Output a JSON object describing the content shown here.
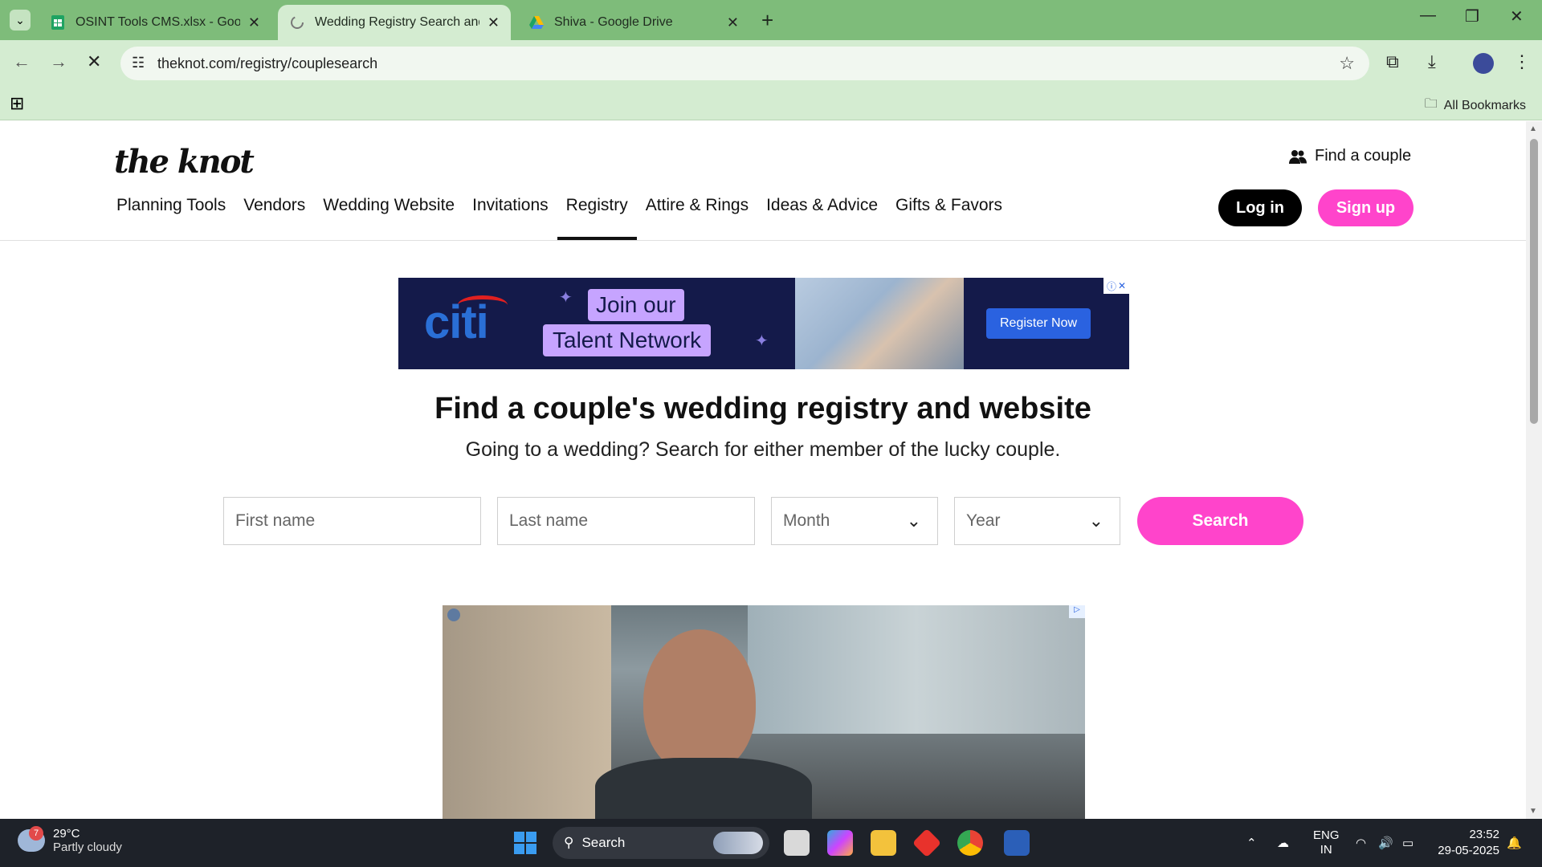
{
  "browser": {
    "tabs": [
      {
        "title": "OSINT Tools CMS.xlsx - Google",
        "icon": "sheets-icon",
        "active": false
      },
      {
        "title": "Wedding Registry Search and W",
        "icon": "loading-icon",
        "active": true
      },
      {
        "title": "Shiva - Google Drive",
        "icon": "drive-icon",
        "active": false
      }
    ],
    "url": "theknot.com/registry/couplesearch",
    "bookmarks_label": "All Bookmarks"
  },
  "site": {
    "logo": "the knot",
    "find_couple": "Find a couple",
    "nav": [
      "Planning Tools",
      "Vendors",
      "Wedding Website",
      "Invitations",
      "Registry",
      "Attire & Rings",
      "Ideas & Advice",
      "Gifts & Favors"
    ],
    "active_nav": "Registry",
    "login": "Log in",
    "signup": "Sign up"
  },
  "ad": {
    "brand": "citi",
    "line1": "Join our",
    "line2": "Talent Network",
    "cta": "Register Now"
  },
  "search": {
    "heading": "Find a couple's wedding registry and website",
    "subheading": "Going to a wedding? Search for either member of the lucky couple.",
    "first_name_placeholder": "First name",
    "last_name_placeholder": "Last name",
    "month_label": "Month",
    "year_label": "Year",
    "button": "Search"
  },
  "taskbar": {
    "weather_temp": "29°C",
    "weather_desc": "Partly cloudy",
    "weather_badge": "7",
    "search_label": "Search",
    "lang1": "ENG",
    "lang2": "IN",
    "time": "23:52",
    "date": "29-05-2025"
  }
}
